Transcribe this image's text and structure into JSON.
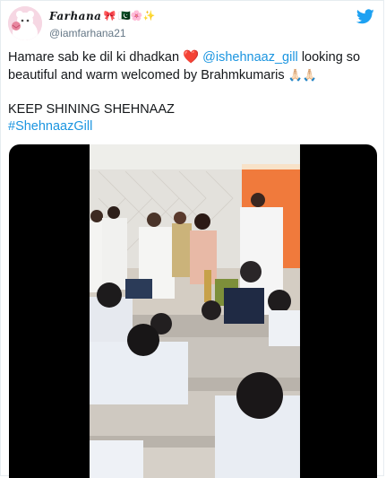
{
  "author": {
    "display_name": "Farhana",
    "name_emoji": "🎀 🇵🇰🌸✨",
    "handle": "@iamfarhana21",
    "avatar_icon": "avatar-icon"
  },
  "brand_icon": "twitter-bird-icon",
  "colors": {
    "text": "#14171a",
    "secondary": "#657786",
    "link": "#1b95e0",
    "heart": "#e0245e",
    "twitter_blue": "#1da1f2"
  },
  "tweet": {
    "line1_prefix": "Hamare sab ke dil ki dhadkan",
    "heart": "❤️",
    "mention": "@ishehnaaz_gill",
    "line1_suffix": "looking so beautiful and warm welcomed by Brahmkumaris",
    "pray": "🙏🏻🙏🏻",
    "line2": "KEEP SHINING SHEHNAAZ",
    "hashtag": "#ShehnaazGill"
  }
}
